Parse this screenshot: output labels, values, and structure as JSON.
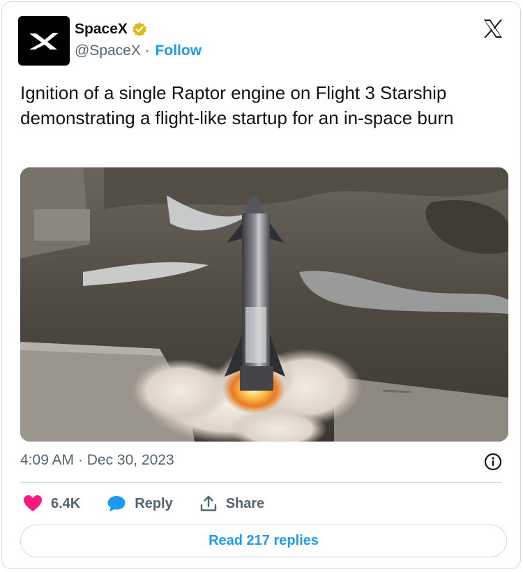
{
  "author": {
    "name": "SpaceX",
    "handle": "@SpaceX",
    "separator": " · ",
    "follow_label": "Follow"
  },
  "tweet": {
    "text": "Ignition of a single Raptor engine on Flight 3 Starship demonstrating a flight-like startup for an in-space burn",
    "time": "4:09 AM",
    "date_separator": " · ",
    "date": "Dec 30, 2023"
  },
  "actions": {
    "like_count": "6.4K",
    "reply_label": "Reply",
    "share_label": "Share"
  },
  "read_replies_label": "Read 217 replies",
  "colors": {
    "accent": "#1d9bf0",
    "like": "#f91880",
    "verified": "#e2b719",
    "text_secondary": "#536471",
    "border": "#cfd9de"
  },
  "icons": [
    "spacex-logo-icon",
    "verified-badge-icon",
    "x-logo-icon",
    "info-icon",
    "heart-icon",
    "reply-bubble-icon",
    "share-icon"
  ]
}
